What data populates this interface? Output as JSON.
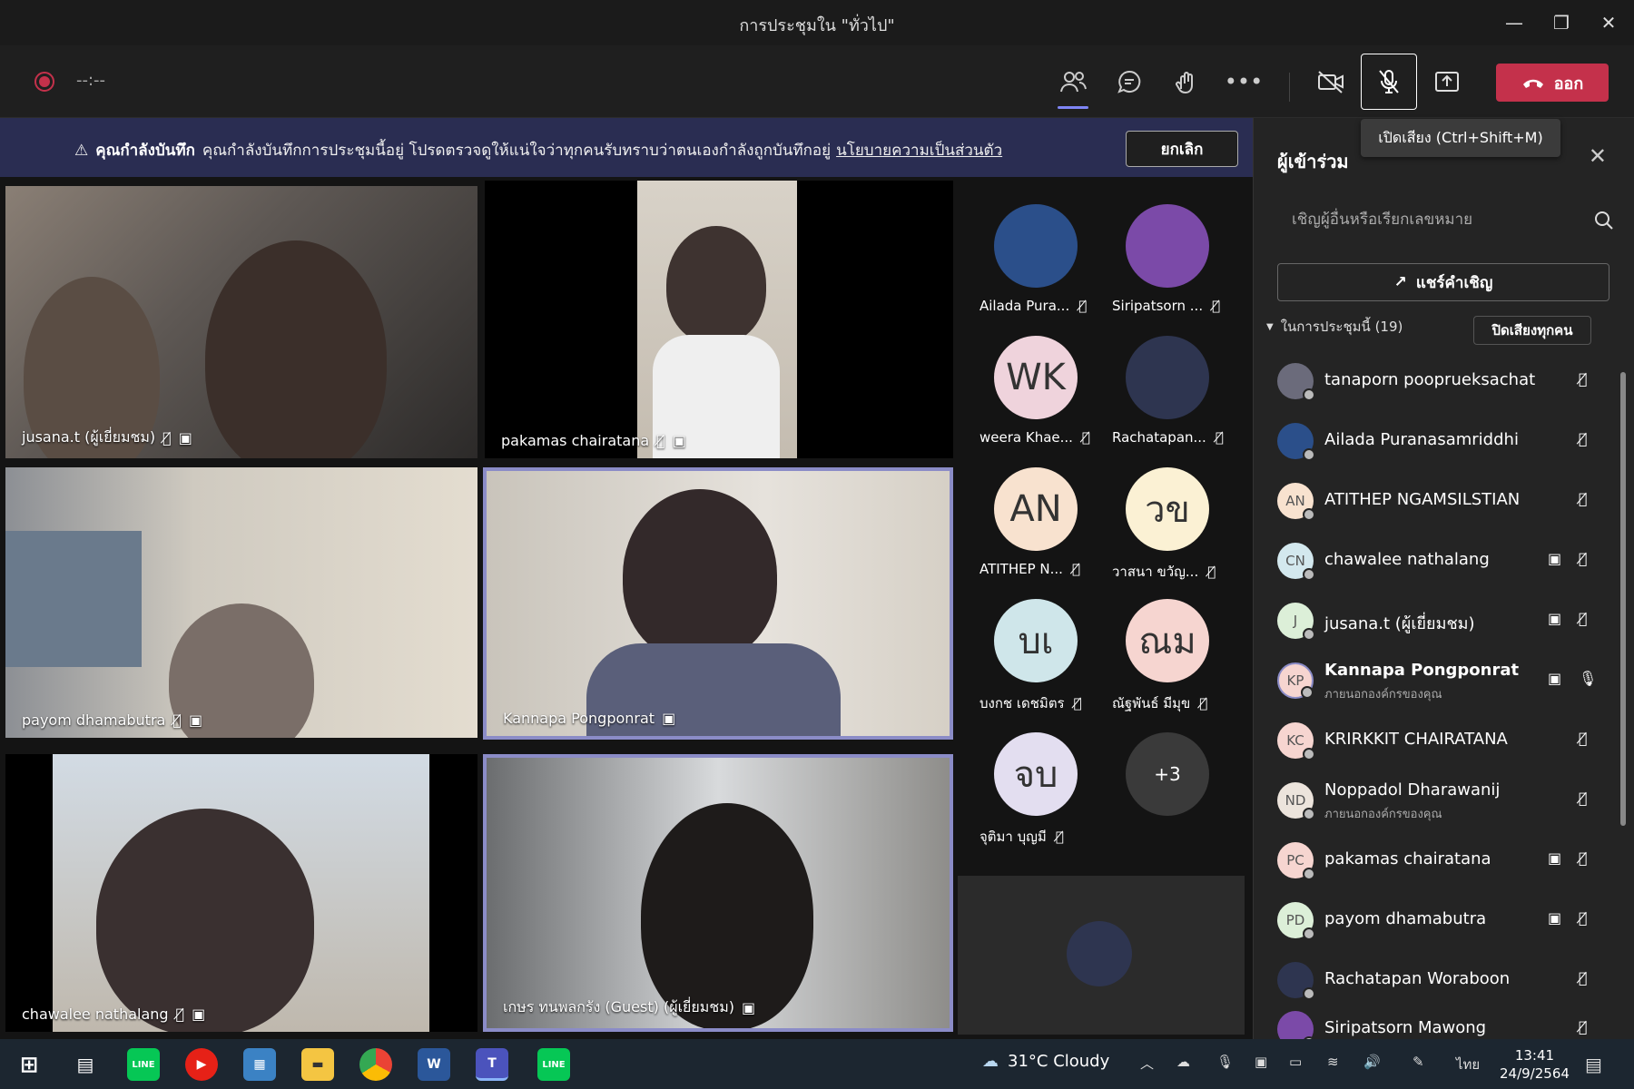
{
  "window": {
    "title": "การประชุมใน \"ทั่วไป\""
  },
  "toolbar": {
    "timer": "--:--",
    "leave_label": "ออก",
    "mic_tooltip": "เปิดเสียง (Ctrl+Shift+M)"
  },
  "banner": {
    "heading": "คุณกำลังบันทึก",
    "message": "คุณกำลังบันทึกการประชุมนี้อยู่ โปรดตรวจดูให้แน่ใจว่าทุกคนรับทราบว่าตนเองกำลังถูกบันทึกอยู่",
    "link": "นโยบายความเป็นส่วนตัว",
    "cancel_label": "ยกเลิก"
  },
  "tiles": [
    {
      "label": "jusana.t (ผู้เยี่ยมชม)"
    },
    {
      "label": "pakamas chairatana"
    },
    {
      "label": "payom dhamabutra"
    },
    {
      "label": "Kannapa Pongponrat"
    },
    {
      "label": "chawalee nathalang"
    },
    {
      "label": "เกษร ทนพลกรัง (Guest) (ผู้เยี่ยมชม)"
    }
  ],
  "roster": [
    {
      "name": "Ailada Pura...",
      "initials": "",
      "color": "#2b4f8a"
    },
    {
      "name": "Siripatsorn ...",
      "initials": "",
      "color": "#7b4aa8"
    },
    {
      "name": "weera Khae...",
      "initials": "WK",
      "color": "#efd3dc"
    },
    {
      "name": "Rachatapan...",
      "initials": "",
      "color": "#2e3550"
    },
    {
      "name": "ATITHEP N...",
      "initials": "AN",
      "color": "#f8e2cf"
    },
    {
      "name": "วาสนา ขวัญ...",
      "initials": "วข",
      "color": "#fbf1d4"
    },
    {
      "name": "บงกช เดชมิตร",
      "initials": "บเ",
      "color": "#cfe6ea"
    },
    {
      "name": "ณัฐพันธ์ มีมุข",
      "initials": "ณม",
      "color": "#f6d5d0"
    },
    {
      "name": "จุติมา บุญมี",
      "initials": "จบ",
      "color": "#e3def0"
    },
    {
      "name": "",
      "initials": "+3",
      "color": "#3a3a3a"
    }
  ],
  "panel": {
    "title": "ผู้เข้าร่วม",
    "invite_placeholder": "เชิญผู้อื่นหรือเรียกเลขหมาย",
    "share_label": "แชร์คำเชิญ",
    "section_label": "ในการประชุมนี้ (19)",
    "mute_all_label": "ปิดเสียงทุกคน",
    "participants": [
      {
        "name": "tanaporn pooprueksachat",
        "initials": "",
        "sub": "",
        "color": "#6b6b7b"
      },
      {
        "name": "Ailada Puranasamriddhi",
        "initials": "",
        "sub": "",
        "color": "#2b4f8a"
      },
      {
        "name": "ATITHEP NGAMSILSTIAN",
        "initials": "AN",
        "sub": "",
        "color": "#f8e2cf"
      },
      {
        "name": "chawalee nathalang",
        "initials": "CN",
        "sub": "",
        "color": "#d3e8ee"
      },
      {
        "name": "jusana.t (ผู้เยี่ยมชม)",
        "initials": "J",
        "sub": "",
        "color": "#dcefd8"
      },
      {
        "name": "Kannapa Pongponrat",
        "initials": "KP",
        "sub": "ภายนอกองค์กรของคุณ",
        "color": "#f6d5d0"
      },
      {
        "name": "KRIRKKIT CHAIRATANA",
        "initials": "KC",
        "sub": "",
        "color": "#f6d5d0"
      },
      {
        "name": "Noppadol Dharawanij",
        "initials": "ND",
        "sub": "ภายนอกองค์กรของคุณ",
        "color": "#ece4dc"
      },
      {
        "name": "pakamas chairatana",
        "initials": "PC",
        "sub": "",
        "color": "#f6d5d0"
      },
      {
        "name": "payom dhamabutra",
        "initials": "PD",
        "sub": "",
        "color": "#dcefd8"
      },
      {
        "name": "Rachatapan Woraboon",
        "initials": "",
        "sub": "",
        "color": "#2e3550"
      },
      {
        "name": "Siripatsorn Mawong",
        "initials": "",
        "sub": "",
        "color": "#7b4aa8"
      }
    ]
  },
  "taskbar": {
    "weather": "31°C  Cloudy",
    "lang": "ไทย",
    "time": "13:41",
    "date": "24/9/2564"
  }
}
